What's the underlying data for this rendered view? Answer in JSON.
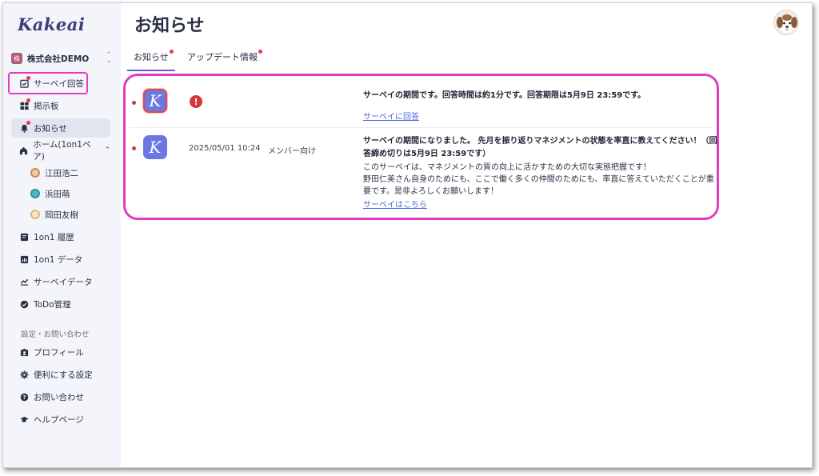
{
  "app": {
    "logo": "Kakeai",
    "company_badge": "株",
    "company_name": "株式会社DEMO",
    "company_switch": "⌃⌄"
  },
  "page": {
    "title": "お知らせ"
  },
  "sidebar": {
    "items": [
      {
        "label": "サーベイ回答",
        "icon": "survey-check-icon",
        "badge": true
      },
      {
        "label": "掲示板",
        "icon": "board-icon",
        "badge": true
      },
      {
        "label": "お知らせ",
        "icon": "bell-icon",
        "badge": true,
        "active": true
      },
      {
        "label": "ホーム(1on1ペア)",
        "icon": "home-icon",
        "chevron": "⌃"
      },
      {
        "label": "江田浩二",
        "icon": "avatar-icon"
      },
      {
        "label": "浜田萌",
        "icon": "avatar-icon"
      },
      {
        "label": "岡田友樹",
        "icon": "avatar-icon"
      },
      {
        "label": "1on1 履歴",
        "icon": "history-icon"
      },
      {
        "label": "1on1 データ",
        "icon": "chart-icon"
      },
      {
        "label": "サーベイデータ",
        "icon": "survey-data-icon"
      },
      {
        "label": "ToDo管理",
        "icon": "todo-icon"
      }
    ],
    "settings_label": "設定・お問い合わせ",
    "settings_items": [
      {
        "label": "プロフィール",
        "icon": "profile-icon"
      },
      {
        "label": "便利にする設定",
        "icon": "gear-icon"
      },
      {
        "label": "お問い合わせ",
        "icon": "question-icon"
      },
      {
        "label": "ヘルプページ",
        "icon": "graduation-cap-icon"
      }
    ]
  },
  "tabs": [
    {
      "label": "お知らせ",
      "active": true,
      "badge": true
    },
    {
      "label": "アップデート情報",
      "active": false,
      "badge": true
    }
  ],
  "notifications": [
    {
      "unread": true,
      "icon": "kakeai-logo-icon",
      "icon_letter": "K",
      "alert": "!",
      "date": "",
      "audience": "",
      "title": "サーベイの期間です。回答時間は約1分です。回答期限は5月9日 23:59です。",
      "body": [],
      "link": "サーベイに回答"
    },
    {
      "unread": true,
      "icon": "kakeai-logo-icon",
      "icon_letter": "K",
      "date": "2025/05/01 10:24",
      "audience": "メンバー向け",
      "title_lines": [
        "サーベイの期間になりました。 先月を振り返りマネジメントの状態を率直に教えてください！（回",
        "答締め切りは5月9日 23:59です）"
      ],
      "body": [
        "このサーベイは、マネジメントの質の向上に活かすための大切な実態把握です！",
        "野田仁美さん自身のためにも、ここで働く多くの仲間のためにも、率直に答えていただくことが重",
        "要です。是非よろしくお願いします！"
      ],
      "link": "サーベイはこちら"
    }
  ],
  "colors": {
    "highlight": "#e23cc2",
    "unread": "#d6334d",
    "brand": "#6a78e4",
    "link": "#4b6ad8",
    "tab_underline": "#5866d6"
  }
}
